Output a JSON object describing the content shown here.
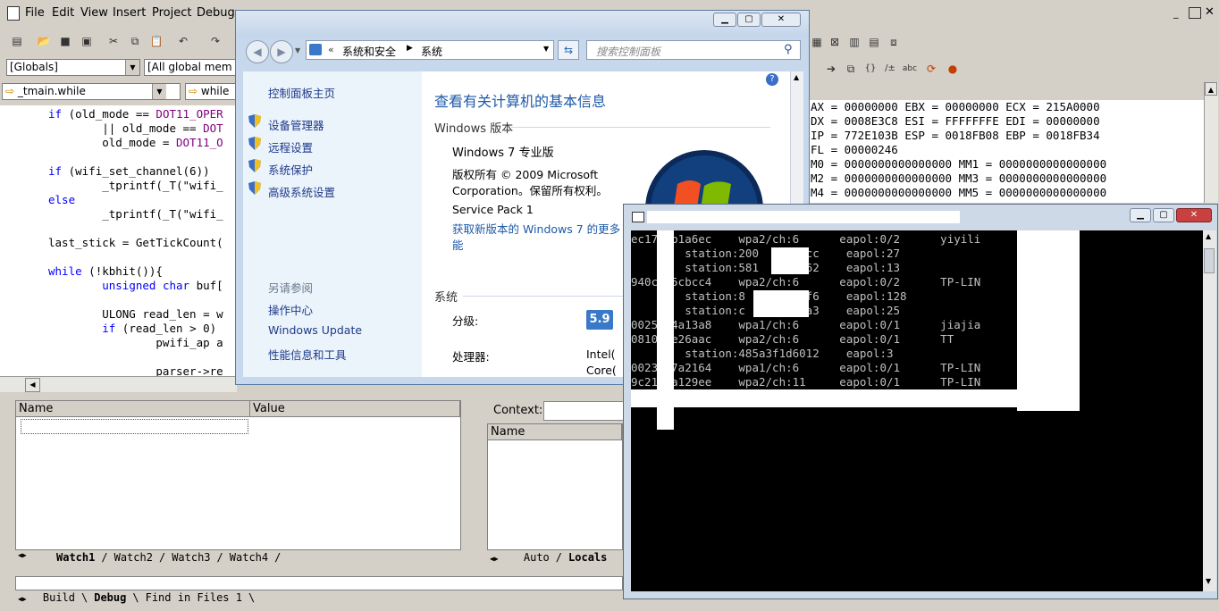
{
  "ide": {
    "menu": [
      "File",
      "Edit",
      "View",
      "Insert",
      "Project",
      "Debug"
    ],
    "scope_combo": "[Globals]",
    "members_combo": "[All global mem",
    "location_combo": "_tmain.while",
    "wizard_combo": "while",
    "code_lines": [
      "if (old_mode == DOT11_OPER",
      "        || old_mode == DOT",
      "        old_mode = DOT11_O",
      "",
      "if (wifi_set_channel(6))",
      "        _tprintf(_T(\"wifi_",
      "else",
      "        _tprintf(_T(\"wifi_",
      "",
      "last_stick = GetTickCount(",
      "",
      "while (!kbhit()){",
      "        unsigned char buf[",
      "",
      "        ULONG read_len = w",
      "        if (read_len > 0)",
      "                pwifi_ap a",
      "",
      "                parser->re"
    ],
    "registers": [
      "AX = 00000000 EBX = 00000000 ECX = 215A0000",
      "DX = 0008E3C8 ESI = FFFFFFFE EDI = 00000000",
      "IP = 772E103B ESP = 0018FB08 EBP = 0018FB34",
      "FL = 00000246",
      "M0 = 0000000000000000 MM1 = 0000000000000000",
      "M2 = 0000000000000000 MM3 = 0000000000000000",
      "M4 = 0000000000000000 MM5 = 0000000000000000"
    ],
    "watch": {
      "col_name": "Name",
      "col_value": "Value",
      "tabs": [
        "Watch1",
        "Watch2",
        "Watch3",
        "Watch4"
      ],
      "active_tab": "Watch1"
    },
    "variables": {
      "context_label": "Context:",
      "col_name": "Name",
      "tabs": [
        "Auto",
        "Locals"
      ],
      "active_tab": "Locals"
    },
    "output_tabs": [
      "Build",
      "Debug",
      "Find in Files 1"
    ],
    "output_active_tab": "Debug"
  },
  "control_panel": {
    "breadcrumb": [
      "系统和安全",
      "系统"
    ],
    "search_placeholder": "搜索控制面板",
    "sidebar_home": "控制面板主页",
    "sidebar_links": [
      "设备管理器",
      "远程设置",
      "系统保护",
      "高级系统设置"
    ],
    "see_also_title": "另请参阅",
    "see_also_links": [
      "操作中心",
      "Windows Update",
      "性能信息和工具"
    ],
    "page_title": "查看有关计算机的基本信息",
    "edition_section": "Windows 版本",
    "edition": "Windows 7 专业版",
    "copyright_1": "版权所有 © 2009 Microsoft",
    "copyright_2": "Corporation。保留所有权利。",
    "service_pack": "Service Pack 1",
    "upgrade_link_1": "获取新版本的 Windows 7 的更多",
    "upgrade_link_2": "能",
    "system_section": "系统",
    "rating_label": "分级:",
    "rating_value": "5.9",
    "processor_label": "处理器:",
    "processor_value_1": "Intel(",
    "processor_value_2": "Core("
  },
  "console": {
    "rows": [
      "ec17  b1a6ec    wpa2/ch:6      eapol:0/2      yiyili",
      "        station:200      5cc    eapol:27",
      "        station:581      f62    eapol:13",
      "940c  5cbcc4    wpa2/ch:6      eapol:0/2      TP-LIN",
      "        station:8        ff6    eapol:128",
      "        station:c        7a3    eapol:25",
      "0025  4a13a8    wpa1/ch:6      eapol:0/1      jiajia",
      "0810  e26aac    wpa2/ch:6      eapol:0/1      TT",
      "        station:485a3f1d6012    eapol:3",
      "0023  7a2164    wpa1/ch:6      eapol:0/1      TP-LIN",
      "9c21  a129ee    wpa2/ch:11     eapol:0/1      TP-LIN"
    ]
  },
  "colors": {
    "classic_gray": "#d4d0c8",
    "code_keyword": "#0000ff",
    "code_constant": "#800080",
    "link_blue": "#1f3a8a",
    "title_blue": "#1e5aa8"
  }
}
